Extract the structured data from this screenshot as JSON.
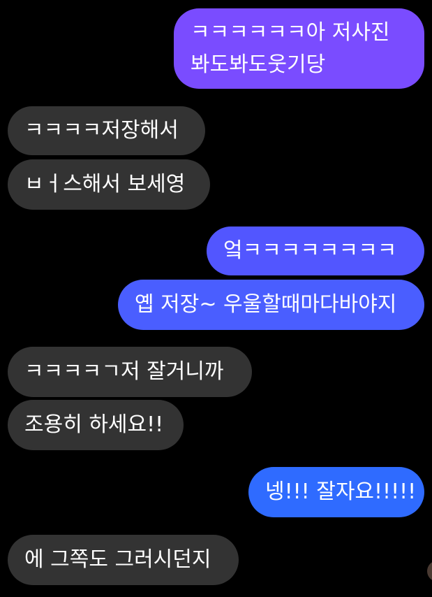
{
  "messages": [
    {
      "side": "sent",
      "text": "ㅋㅋㅋㅋㅋㅋ아 저사진 봐도봐도웃기당"
    },
    {
      "side": "received",
      "text": "ㅋㅋㅋㅋ저장해서"
    },
    {
      "side": "received",
      "text": "ㅂㅓ스해서 보세영"
    },
    {
      "side": "sent",
      "text": "엌ㅋㅋㅋㅋㅋㅋㅋㅋ"
    },
    {
      "side": "sent",
      "text": "옙 저장~ 우울할때마다바야지"
    },
    {
      "side": "received",
      "text": "ㅋㅋㅋㅋㄱ저 잘거니까"
    },
    {
      "side": "received",
      "text": "조용히 하세요!!"
    },
    {
      "side": "sent",
      "text": "넹!!! 잘자요!!!!!"
    },
    {
      "side": "received",
      "text": "에 그쪽도 그러시던지"
    }
  ],
  "colors": {
    "background": "#000000",
    "received_bubble": "#333333",
    "sent_gradient_top": "#7b4dff",
    "sent_gradient_bottom": "#2f6bff"
  }
}
